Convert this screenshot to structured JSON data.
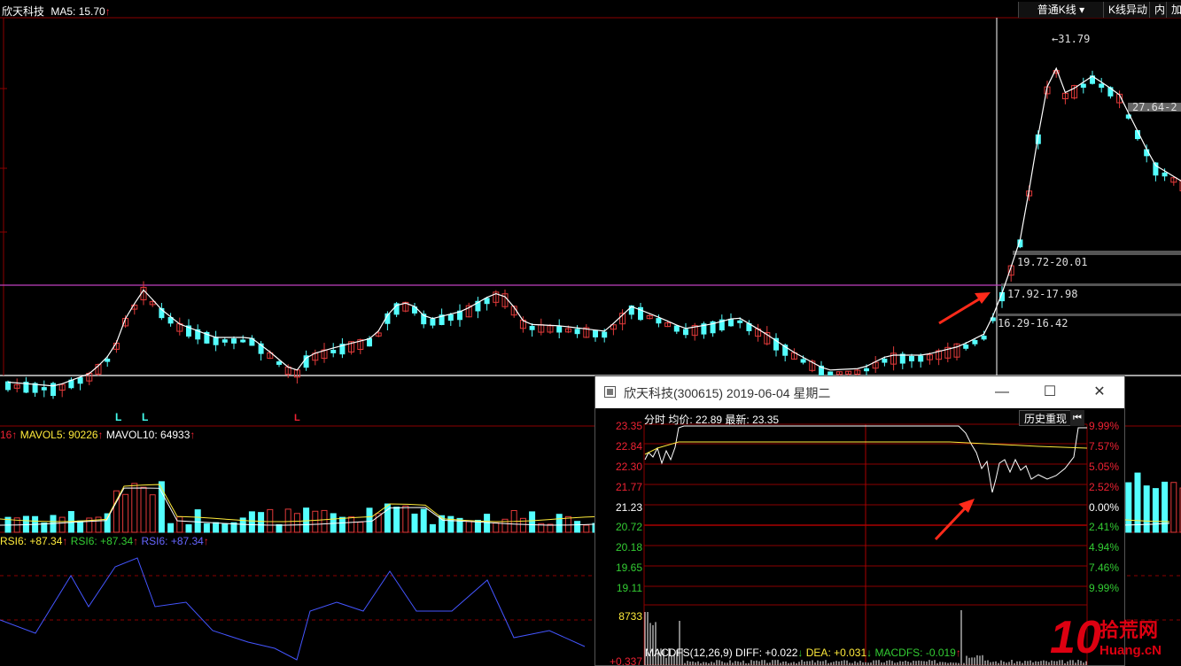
{
  "header": {
    "stock_name": "欣天科技",
    "ma5_label": "MA5: 15.70",
    "ma5_arrow": "↑"
  },
  "toolbar": {
    "kline_type": "普通K线",
    "kline_move": "K线异动",
    "inner": "内",
    "add": "加"
  },
  "chart_labels": {
    "high_price": "31.79",
    "range1": "27.64-2",
    "range2": "19.72-20.01",
    "range3": "17.92-17.98",
    "range4": "16.29-16.42",
    "low_markers": [
      "L",
      "L",
      "L"
    ]
  },
  "volume_panel": {
    "prefix": "16↑",
    "mavol5": "MAVOL5: 90226",
    "mavol5_arrow": "↑",
    "mavol10": "MAVOL10: 64933",
    "mavol10_arrow": "↑"
  },
  "rsi_panel": {
    "rsi1": "RSI6: +87.34",
    "rsi1_arrow": "↑",
    "rsi2": "RSI6: +87.34",
    "rsi2_arrow": "↑",
    "rsi3": "RSI6: +87.34",
    "rsi3_arrow": "↑"
  },
  "popup": {
    "title": "欣天科技(300615) 2019-06-04 星期二",
    "minimize": "—",
    "maximize": "☐",
    "close": "✕",
    "mode": "分时",
    "avg_price": "均价: 22.89",
    "latest": "最新: 23.35",
    "history_replay": "历史重现",
    "play_icon": "⏮",
    "left_axis": [
      "23.35",
      "22.84",
      "22.30",
      "21.77",
      "21.23",
      "20.72",
      "20.18",
      "19.65",
      "19.11",
      "8733",
      "+0.337"
    ],
    "right_axis": [
      "9.99%",
      "7.57%",
      "5.05%",
      "2.52%",
      "0.00%",
      "2.41%",
      "4.94%",
      "7.46%",
      "9.99%"
    ],
    "macd": {
      "name": "MACDFS(12,26,9)",
      "diff": "DIFF: +0.022",
      "diff_arrow": "↓",
      "dea": "DEA: +0.031",
      "dea_arrow": "↓",
      "macdfs": "MACDFS: -0.019",
      "macdfs_arrow": "↑"
    }
  },
  "watermark": {
    "number": "10",
    "site_cn": "拾荒网",
    "site_url": "Huang.cN"
  },
  "colors": {
    "up": "#e23a3a",
    "down": "#54ffff",
    "ma_line": "#ffffff",
    "purple_line": "#c040c0",
    "grid_red": "#8b0000",
    "arrow_red": "#ff2a1a"
  }
}
